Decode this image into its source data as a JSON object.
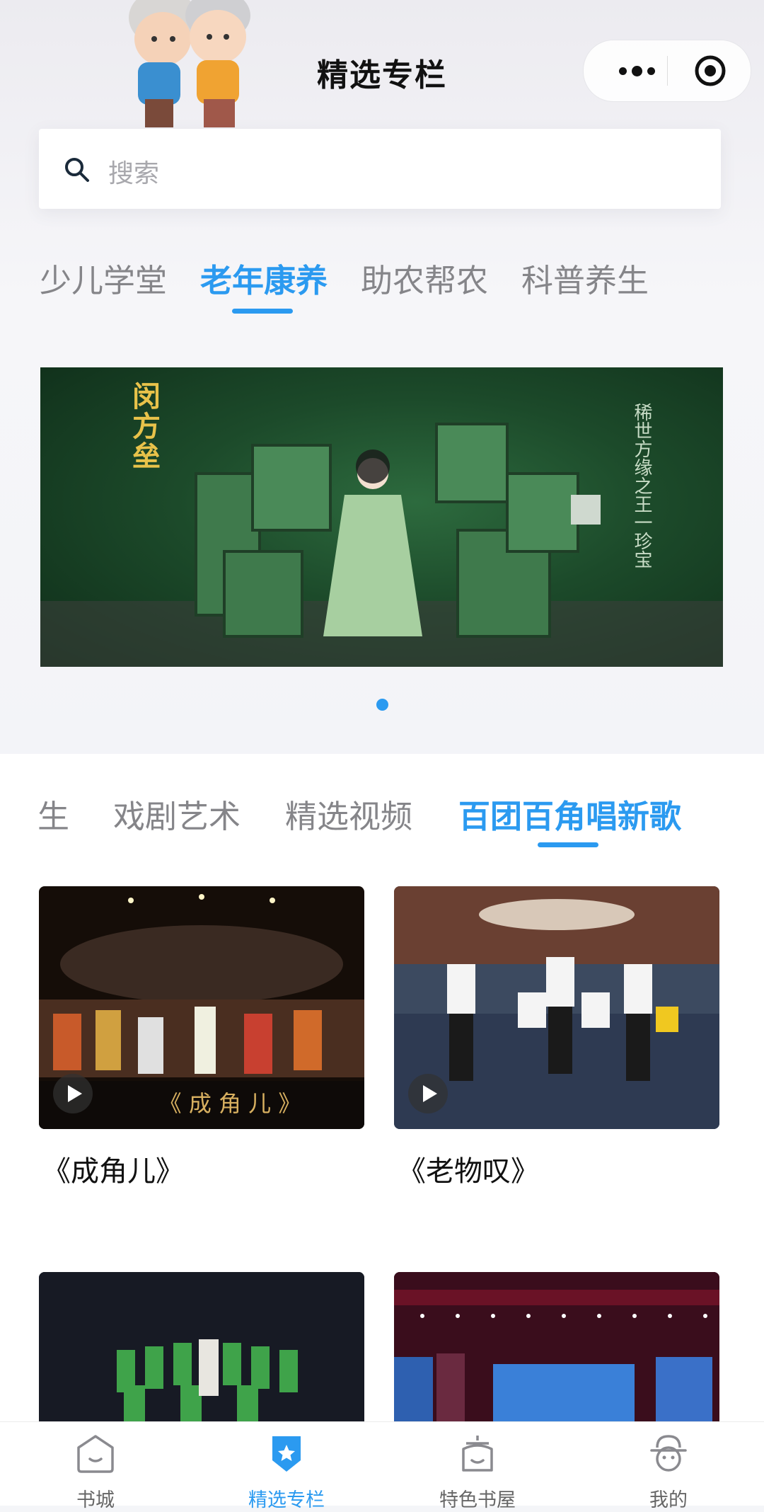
{
  "header": {
    "title": "精选专栏"
  },
  "search": {
    "placeholder": "搜索"
  },
  "category_tabs": [
    {
      "label": "少儿学堂",
      "active": false
    },
    {
      "label": "老年康养",
      "active": true
    },
    {
      "label": "助农帮农",
      "active": false
    },
    {
      "label": "科普养生",
      "active": false
    }
  ],
  "banner": {
    "title": "闵方垒",
    "side_text": "稀世方缘之王一珍宝",
    "carousel_count": 1,
    "carousel_index": 0
  },
  "sub_tabs": [
    {
      "label": "生",
      "active": false
    },
    {
      "label": "戏剧艺术",
      "active": false
    },
    {
      "label": "精选视频",
      "active": false
    },
    {
      "label": "百团百角唱新歌",
      "active": true
    }
  ],
  "videos": [
    {
      "caption": "《成角儿》",
      "overlay_title": "《 成 角 儿 》"
    },
    {
      "caption": "《老物叹》"
    },
    {
      "caption": ""
    },
    {
      "caption": ""
    }
  ],
  "tabbar": [
    {
      "label": "书城",
      "icon": "bookstore-home-icon",
      "active": false
    },
    {
      "label": "精选专栏",
      "icon": "featured-badge-icon",
      "active": true
    },
    {
      "label": "特色书屋",
      "icon": "special-house-icon",
      "active": false
    },
    {
      "label": "我的",
      "icon": "profile-icon",
      "active": false
    }
  ],
  "colors": {
    "accent": "#2b9af0",
    "inactive": "#858589"
  }
}
